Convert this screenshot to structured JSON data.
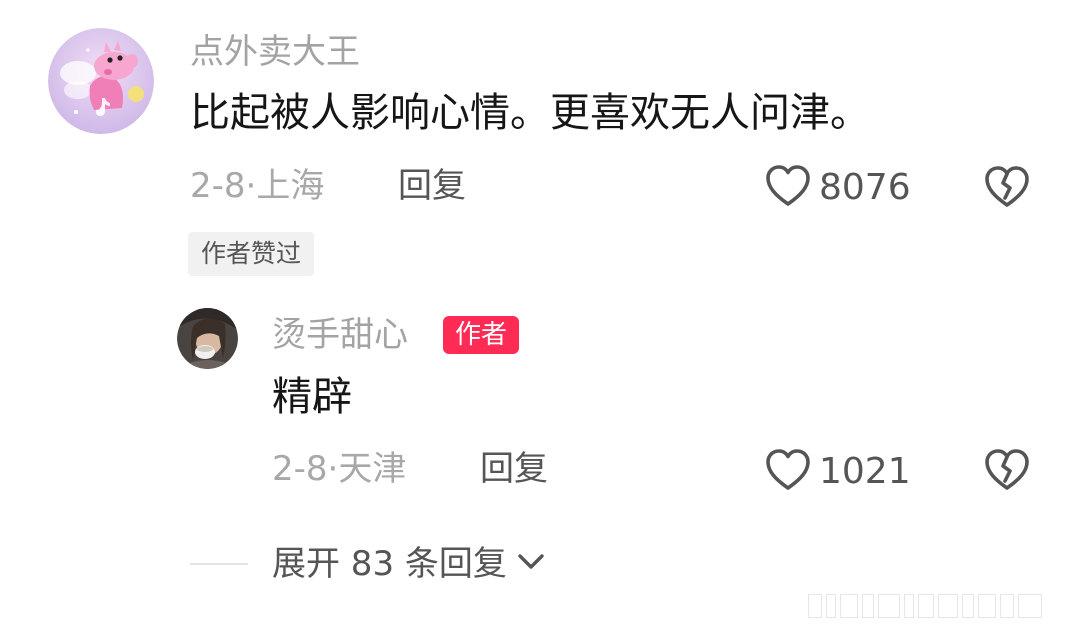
{
  "comment": {
    "username": "点外卖大王",
    "text": "比起被人影响心情。更喜欢无人问津。",
    "meta": "2-8·上海",
    "reply_label": "回复",
    "like_count": "8076",
    "liked_by_author_badge": "作者赞过"
  },
  "reply": {
    "username": "烫手甜心",
    "author_tag": "作者",
    "text": "精辟",
    "meta": "2-8·天津",
    "reply_label": "回复",
    "like_count": "1021"
  },
  "expand": {
    "label": "展开 83 条回复"
  },
  "colors": {
    "username": "#a3a3a3",
    "body_text": "#161616",
    "secondary": "#555555",
    "author_tag_bg": "#fe2c55",
    "badge_bg": "#f1f1f1"
  },
  "icons": {
    "like": "heart-outline-icon",
    "dislike": "broken-heart-icon",
    "expand": "chevron-down-icon"
  }
}
